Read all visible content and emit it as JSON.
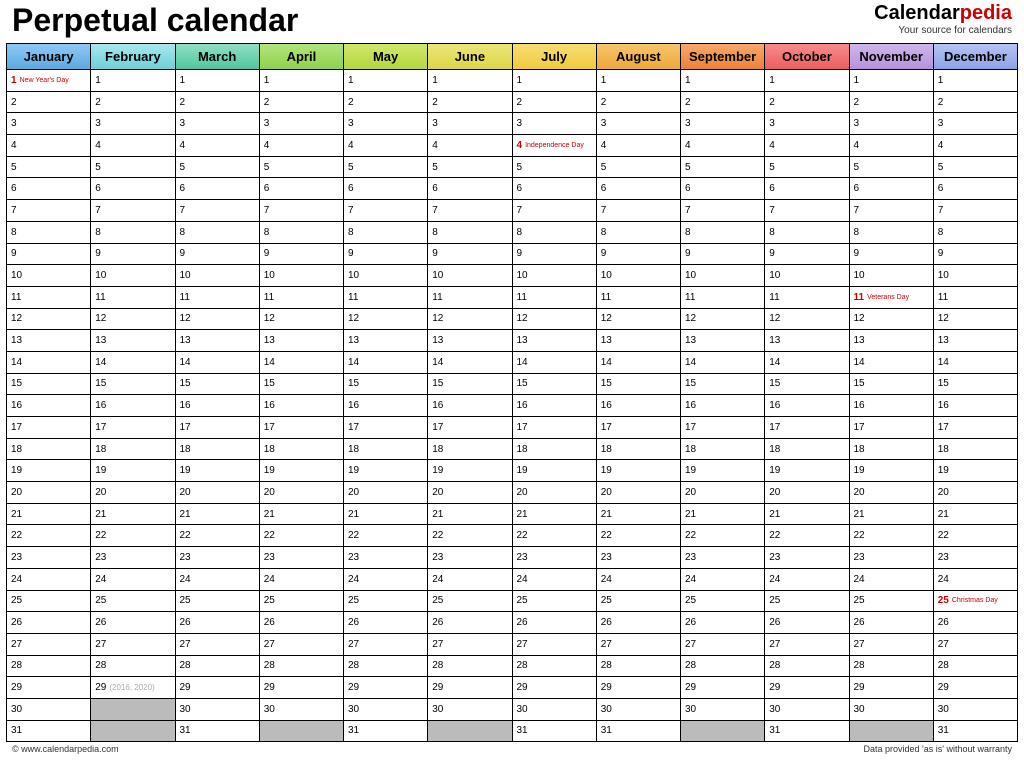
{
  "title": "Perpetual calendar",
  "brand": {
    "part1": "Calendar",
    "part2": "pedia",
    "tagline": "Your source for calendars"
  },
  "months": [
    "January",
    "February",
    "March",
    "April",
    "May",
    "June",
    "July",
    "August",
    "September",
    "October",
    "November",
    "December"
  ],
  "monthDays": [
    31,
    29,
    31,
    30,
    31,
    30,
    31,
    31,
    30,
    31,
    30,
    31
  ],
  "holidays": [
    {
      "month": 0,
      "day": 1,
      "label": "New Year's Day"
    },
    {
      "month": 6,
      "day": 4,
      "label": "Independence Day"
    },
    {
      "month": 10,
      "day": 11,
      "label": "Veterans Day"
    },
    {
      "month": 11,
      "day": 25,
      "label": "Christmas Day"
    }
  ],
  "notes": [
    {
      "month": 1,
      "day": 29,
      "text": "(2016, 2020)"
    }
  ],
  "footer": {
    "copyright": "© www.calendarpedia.com",
    "disclaimer": "Data provided 'as is' without warranty"
  }
}
